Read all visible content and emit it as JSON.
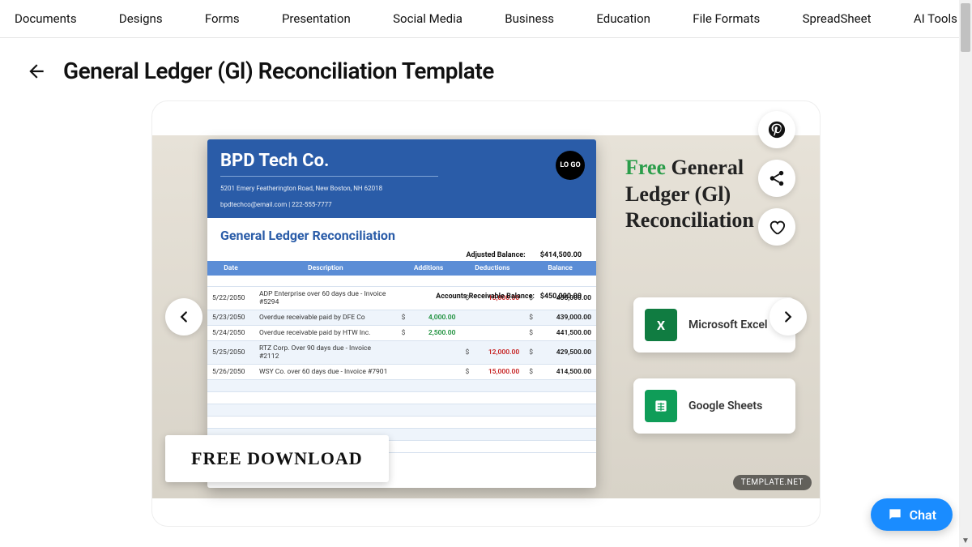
{
  "nav": {
    "items": [
      "Documents",
      "Designs",
      "Forms",
      "Presentation",
      "Social Media",
      "Business",
      "Education",
      "File Formats",
      "SpreadSheet",
      "AI Tools"
    ]
  },
  "page": {
    "title": "General Ledger (Gl) Reconciliation Template"
  },
  "preview": {
    "company": "BPD Tech Co.",
    "address": "5201 Emery Featherington Road, New Boston, NH 62018",
    "contact": "bpdtechco@email.com | 222-555-7777",
    "logo_text": "LO\nGO",
    "doc_title": "General Ledger Reconciliation",
    "adjusted_label": "Adjusted Balance:",
    "adjusted_value": "$414,500.00",
    "ar_label": "Accounts Receivable Balance:",
    "ar_value": "$450,000.00",
    "columns": [
      "Date",
      "Description",
      "Additions",
      "Deductions",
      "Balance"
    ],
    "rows": [
      {
        "date": "5/22/2050",
        "desc": "ADP Enterprise over 60 days due - Invoice #5294",
        "add": "",
        "ded": "15,000.00",
        "bal": "435,000.00"
      },
      {
        "date": "5/23/2050",
        "desc": "Overdue receivable paid by DFE Co",
        "add": "4,000.00",
        "ded": "",
        "bal": "439,000.00"
      },
      {
        "date": "5/24/2050",
        "desc": "Overdue receivable paid by HTW Inc.",
        "add": "2,500.00",
        "ded": "",
        "bal": "441,500.00"
      },
      {
        "date": "5/25/2050",
        "desc": "RTZ Corp. Over 90 days due - Invoice #2112",
        "add": "",
        "ded": "12,000.00",
        "bal": "429,500.00"
      },
      {
        "date": "5/26/2050",
        "desc": "WSY Co. over 60 days due - Invoice #7901",
        "add": "",
        "ded": "15,000.00",
        "bal": "414,500.00"
      }
    ],
    "free_download": "FREE DOWNLOAD",
    "promo_free": "Free",
    "promo_rest": " General Ledger (Gl) Reconciliation",
    "apps": {
      "excel": "Microsoft Excel",
      "sheets": "Google Sheets"
    },
    "watermark": "TEMPLATE.NET"
  },
  "chat": {
    "label": "Chat"
  }
}
